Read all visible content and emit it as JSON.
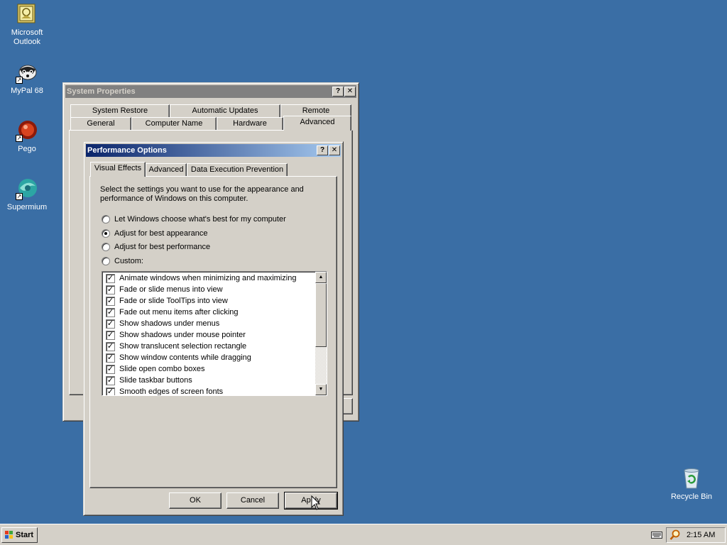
{
  "desktop": {
    "icons": [
      {
        "label_line1": "Microsoft",
        "label_line2": "Outlook",
        "icon": "outlook-icon"
      },
      {
        "label_line1": "MyPal 68",
        "label_line2": "",
        "icon": "mypal-icon"
      },
      {
        "label_line1": "Pego",
        "label_line2": "",
        "icon": "pego-icon"
      },
      {
        "label_line1": "Supermium",
        "label_line2": "",
        "icon": "supermium-icon"
      },
      {
        "label_line1": "Recycle Bin",
        "label_line2": "",
        "icon": "recycle-bin-icon"
      }
    ]
  },
  "system_properties": {
    "title": "System Properties",
    "help": "?",
    "close": "✕",
    "tabs_row1": [
      "System Restore",
      "Automatic Updates",
      "Remote"
    ],
    "tabs_row2": [
      "General",
      "Computer Name",
      "Hardware",
      "Advanced"
    ],
    "selected_tab": "Advanced"
  },
  "performance_options": {
    "title": "Performance Options",
    "help": "?",
    "close": "✕",
    "tabs": [
      "Visual Effects",
      "Advanced",
      "Data Execution Prevention"
    ],
    "selected_tab": "Visual Effects",
    "description_line1": "Select the settings you want to use for the appearance and",
    "description_line2": "performance of Windows on this computer.",
    "options": [
      {
        "label": "Let Windows choose what's best for my computer",
        "selected": false
      },
      {
        "label": "Adjust for best appearance",
        "selected": true
      },
      {
        "label": "Adjust for best performance",
        "selected": false
      },
      {
        "label": "Custom:",
        "selected": false
      }
    ],
    "effects": [
      {
        "label": "Animate windows when minimizing and maximizing",
        "checked": true
      },
      {
        "label": "Fade or slide menus into view",
        "checked": true
      },
      {
        "label": "Fade or slide ToolTips into view",
        "checked": true
      },
      {
        "label": "Fade out menu items after clicking",
        "checked": true
      },
      {
        "label": "Show shadows under menus",
        "checked": true
      },
      {
        "label": "Show shadows under mouse pointer",
        "checked": true
      },
      {
        "label": "Show translucent selection rectangle",
        "checked": true
      },
      {
        "label": "Show window contents while dragging",
        "checked": true
      },
      {
        "label": "Slide open combo boxes",
        "checked": true
      },
      {
        "label": "Slide taskbar buttons",
        "checked": true
      },
      {
        "label": "Smooth edges of screen fonts",
        "checked": true
      }
    ],
    "check_glyph": "✓",
    "buttons": {
      "ok": "OK",
      "cancel": "Cancel",
      "apply": "Apply"
    }
  },
  "taskbar": {
    "start_label": "Start",
    "clock": "2:15 AM"
  },
  "colors": {
    "desktop": "#3a6ea5",
    "face": "#d4d0c8",
    "active_title_start": "#0a246a",
    "active_title_end": "#a6caf0",
    "inactive_title": "#808080"
  }
}
